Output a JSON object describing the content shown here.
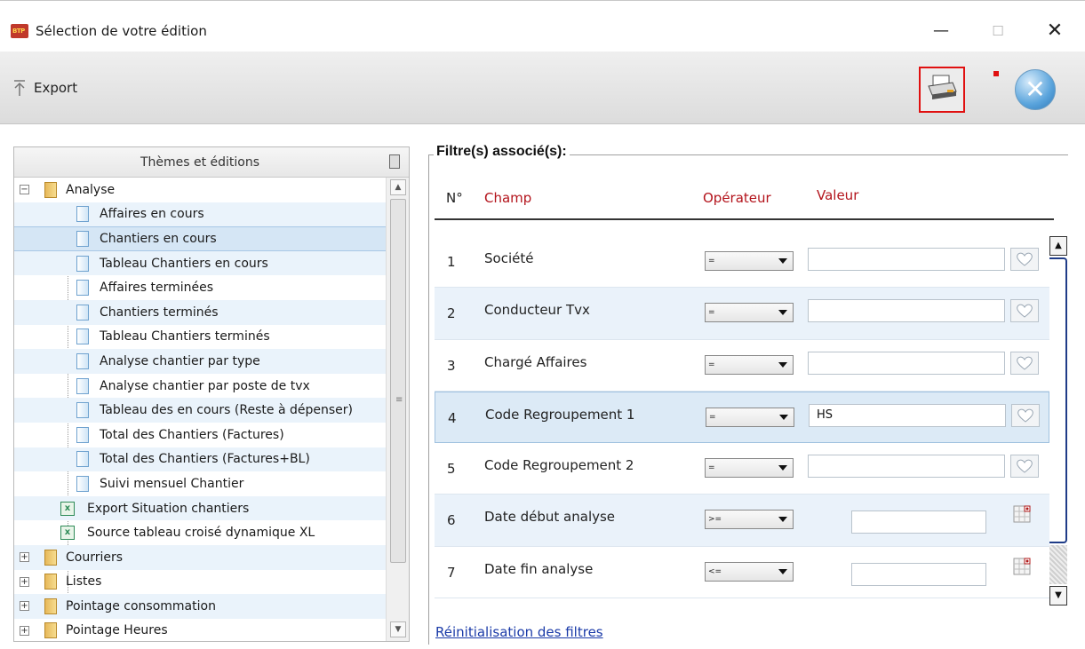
{
  "window": {
    "title": "Sélection de votre édition",
    "app_icon_text": "BTP",
    "minimize": "—",
    "maximize": "☐",
    "close": "✕"
  },
  "toolbar": {
    "export_label": "Export",
    "export_icon": "upload-arrow-icon",
    "print_icon": "printer-icon",
    "close_icon": "close-circle-icon",
    "close_glyph": "✕"
  },
  "tree": {
    "header": "Thèmes et éditions",
    "header_icon": "clipboard-icon",
    "scroll_up": "▲",
    "scroll_down": "▼",
    "scroll_grip": "≡",
    "items": [
      {
        "label": "Analyse",
        "level": 0,
        "type": "folder",
        "expander": "−"
      },
      {
        "label": "Affaires en cours",
        "level": 1,
        "type": "doc"
      },
      {
        "label": "Chantiers en cours",
        "level": 1,
        "type": "doc",
        "selected": true
      },
      {
        "label": "Tableau Chantiers en cours",
        "level": 1,
        "type": "doc"
      },
      {
        "label": "Affaires terminées",
        "level": 1,
        "type": "doc"
      },
      {
        "label": "Chantiers terminés",
        "level": 1,
        "type": "doc"
      },
      {
        "label": "Tableau Chantiers terminés",
        "level": 1,
        "type": "doc"
      },
      {
        "label": "Analyse chantier par type",
        "level": 1,
        "type": "doc"
      },
      {
        "label": "Analyse chantier par poste de tvx",
        "level": 1,
        "type": "doc"
      },
      {
        "label": "Tableau des en cours (Reste à dépenser)",
        "level": 1,
        "type": "doc"
      },
      {
        "label": "Total des Chantiers (Factures)",
        "level": 1,
        "type": "doc"
      },
      {
        "label": "Total des Chantiers (Factures+BL)",
        "level": 1,
        "type": "doc"
      },
      {
        "label": "Suivi mensuel Chantier",
        "level": 1,
        "type": "doc"
      },
      {
        "label": "Export Situation chantiers",
        "level": 1,
        "type": "excel"
      },
      {
        "label": "Source tableau croisé dynamique XL",
        "level": 1,
        "type": "excel"
      },
      {
        "label": "Courriers",
        "level": 0,
        "type": "folder",
        "expander": "+"
      },
      {
        "label": "Listes",
        "level": 0,
        "type": "folder",
        "expander": "+"
      },
      {
        "label": "Pointage consommation",
        "level": 0,
        "type": "folder",
        "expander": "+"
      },
      {
        "label": "Pointage Heures",
        "level": 0,
        "type": "folder",
        "expander": "+"
      }
    ]
  },
  "filters": {
    "legend": "Filtre(s) associé(s):",
    "col_n": "N°",
    "col_champ": "Champ",
    "col_operateur": "Opérateur",
    "col_valeur": "Valeur",
    "rows": [
      {
        "n": "1",
        "champ": "Société",
        "operator": "=",
        "value": "",
        "kind": "text"
      },
      {
        "n": "2",
        "champ": "Conducteur Tvx",
        "operator": "=",
        "value": "",
        "kind": "text"
      },
      {
        "n": "3",
        "champ": "Chargé Affaires",
        "operator": "=",
        "value": "",
        "kind": "text"
      },
      {
        "n": "4",
        "champ": "Code Regroupement 1",
        "operator": "=",
        "value": "HS",
        "kind": "text"
      },
      {
        "n": "5",
        "champ": "Code Regroupement 2",
        "operator": "=",
        "value": "",
        "kind": "text"
      },
      {
        "n": "6",
        "champ": "Date début analyse",
        "operator": ">=",
        "value": "",
        "kind": "date"
      },
      {
        "n": "7",
        "champ": "Date fin analyse",
        "operator": "<=",
        "value": "",
        "kind": "date"
      }
    ],
    "scroll_up": "▲",
    "scroll_down": "▼",
    "reset_link": "Réinitialisation des filtres"
  }
}
